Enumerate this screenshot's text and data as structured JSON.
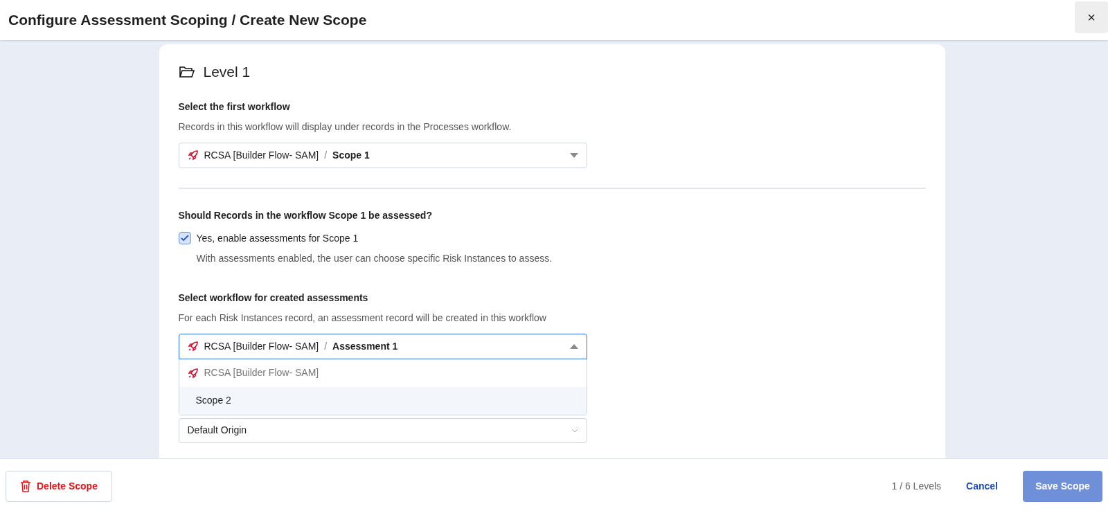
{
  "header": {
    "title": "Configure Assessment Scoping / Create New Scope",
    "close": "×"
  },
  "level": {
    "title": "Level 1"
  },
  "first_workflow": {
    "label": "Select the first workflow",
    "help": "Records in this workflow will display under records in the Processes workflow.",
    "value": {
      "app": "RCSA [Builder Flow- SAM]",
      "separator": "/",
      "workflow": "Scope 1"
    },
    "expanded": false
  },
  "assess": {
    "label": "Should Records in the workflow Scope 1 be assessed?",
    "checkbox": {
      "label": "Yes, enable assessments for Scope 1",
      "help": "With assessments enabled, the user can choose specific Risk Instances to assess.",
      "checked": true
    }
  },
  "assessment_workflow": {
    "label": "Select workflow for created assessments",
    "help": "For each Risk Instances record, an assessment record will be created in this workflow",
    "value": {
      "app": "RCSA [Builder Flow- SAM]",
      "separator": "/",
      "workflow": "Assessment 1"
    },
    "expanded": true,
    "options": [
      {
        "kind": "group",
        "label": "RCSA [Builder Flow- SAM]",
        "highlighted": false
      },
      {
        "kind": "option",
        "label": "Scope 2",
        "highlighted": true
      }
    ]
  },
  "origin": {
    "value": "Default Origin"
  },
  "footer": {
    "delete": "Delete Scope",
    "progress": "1 / 6 Levels",
    "cancel": "Cancel",
    "save": "Save Scope"
  }
}
